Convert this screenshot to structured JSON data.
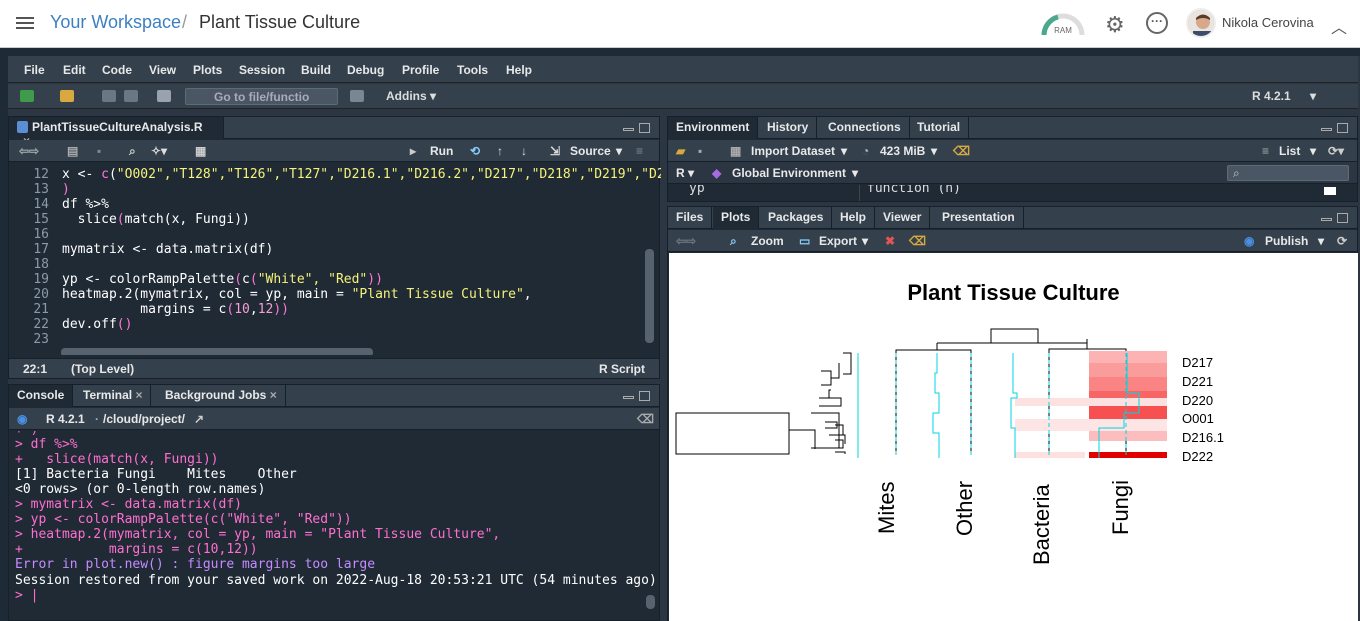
{
  "topbar": {
    "workspace": "Your Workspace",
    "separator": "/",
    "project": "Plant Tissue Culture",
    "ram": "RAM",
    "user": "Nikola Cerovina"
  },
  "menu": [
    "File",
    "Edit",
    "Code",
    "View",
    "Plots",
    "Session",
    "Build",
    "Debug",
    "Profile",
    "Tools",
    "Help"
  ],
  "toolbar": {
    "goto": "Go to file/functio",
    "addins": "Addins",
    "r_version": "R 4.2.1"
  },
  "editor": {
    "file_tab": "PlantTissueCultureAnalysis.R",
    "run": "Run",
    "source": "Source",
    "line_numbers": [
      "12",
      "13",
      "14",
      "15",
      "16",
      "17",
      "18",
      "19",
      "20",
      "21",
      "22",
      "23"
    ],
    "status_pos": "22:1",
    "status_level": "(Top Level)",
    "status_type": "R Script",
    "lines": [
      {
        "a": "x <- ",
        "b": "c",
        "c": "(",
        "d": "\"O002\",\"T128\",\"T126\",\"T127\",\"D216.1\",\"D216.2\",\"D217\",\"D218\",\"D219\",\"D2"
      },
      {
        "a": ")"
      },
      {
        "a": "df %>%"
      },
      {
        "a": "  ",
        "b": "slice",
        "c": "(",
        "e": "match",
        "f": "(x, Fungi))"
      },
      {
        "a": ""
      },
      {
        "a": "mymatrix <- ",
        "b": "data.matrix",
        "c": "(df)"
      },
      {
        "a": ""
      },
      {
        "a": "yp <- ",
        "b": "colorRampPalette",
        "c": "(",
        "e": "c",
        "f": "(",
        "d": "\"White\", \"Red\"",
        "g": "))"
      },
      {
        "a": "heatmap.2",
        "c": "(mymatrix, col = yp, main = ",
        "d": "\"Plant Tissue Culture\"",
        "g": ","
      },
      {
        "a": "          margins = ",
        "b": "c",
        "c": "(",
        "h": "10",
        "i": ",",
        "j": "12",
        "g": "))"
      },
      {
        "a": "dev.off",
        "c": "()"
      },
      {
        "a": ""
      }
    ]
  },
  "console": {
    "tabs": [
      "Console",
      "Terminal",
      "Background Jobs"
    ],
    "r_version": "R 4.2.1",
    "path": "/cloud/project/",
    "lines": [
      {
        "t": "+ )",
        "c": "pk"
      },
      {
        "t": "> df %>%",
        "c": "pk"
      },
      {
        "t": "+   slice(match(x, Fungi))",
        "c": "pk"
      },
      {
        "t": "[1] Bacteria Fungi    Mites    Other",
        "c": "wh"
      },
      {
        "t": "<0 rows> (or 0-length row.names)",
        "c": "wh"
      },
      {
        "t": "> mymatrix <- data.matrix(df)",
        "c": "pk"
      },
      {
        "t": "> yp <- colorRampPalette(c(\"White\", \"Red\"))",
        "c": "pk"
      },
      {
        "t": "> heatmap.2(mymatrix, col = yp, main = \"Plant Tissue Culture\",",
        "c": "pk"
      },
      {
        "t": "+           margins = c(10,12))",
        "c": "pk"
      },
      {
        "t": "Error in plot.new() : figure margins too large",
        "c": "er"
      },
      {
        "t": "Session restored from your saved work on 2022-Aug-18 20:53:21 UTC (54 minutes ago)",
        "c": "wh"
      },
      {
        "t": "> |",
        "c": "pk"
      }
    ]
  },
  "env": {
    "tabs": [
      "Environment",
      "History",
      "Connections",
      "Tutorial"
    ],
    "import": "Import Dataset",
    "memory": "423 MiB",
    "list": "List",
    "lang": "R",
    "scope": "Global Environment",
    "row_name": "yp",
    "row_value": "function (n)"
  },
  "files": {
    "tabs": [
      "Files",
      "Plots",
      "Packages",
      "Help",
      "Viewer",
      "Presentation"
    ],
    "zoom": "Zoom",
    "export": "Export",
    "publish": "Publish"
  },
  "plot": {
    "title": "Plant Tissue Culture",
    "row_labels": [
      "D217",
      "D221",
      "D220",
      "O001",
      "D216.1",
      "D222"
    ],
    "col_labels": [
      "Mites",
      "Other",
      "Bacteria",
      "Fungi"
    ]
  }
}
